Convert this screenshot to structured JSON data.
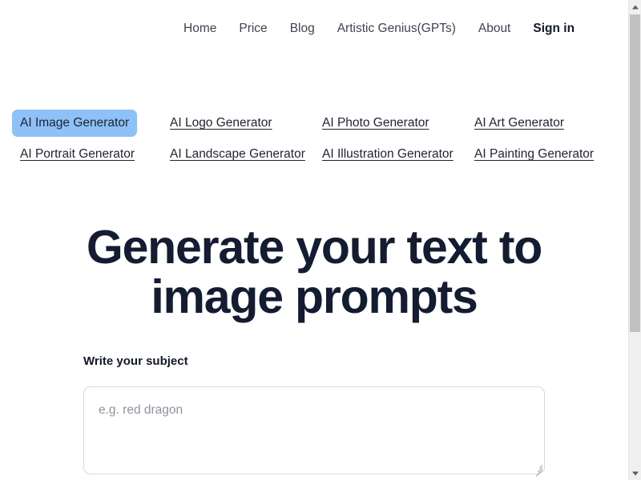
{
  "nav": {
    "items": [
      {
        "label": "Home",
        "emphasis": false
      },
      {
        "label": "Price",
        "emphasis": false
      },
      {
        "label": "Blog",
        "emphasis": false
      },
      {
        "label": "Artistic Genius(GPTs)",
        "emphasis": false
      },
      {
        "label": "About",
        "emphasis": false
      },
      {
        "label": "Sign in",
        "emphasis": true
      }
    ]
  },
  "generator_links": [
    {
      "label": "AI Image Generator",
      "selected": true
    },
    {
      "label": "AI Logo Generator",
      "selected": false
    },
    {
      "label": "AI Photo Generator",
      "selected": false
    },
    {
      "label": "AI Art Generator",
      "selected": false
    },
    {
      "label": "AI Portrait Generator",
      "selected": false
    },
    {
      "label": "AI Landscape Generator",
      "selected": false
    },
    {
      "label": "AI Illustration Generator",
      "selected": false
    },
    {
      "label": "AI Painting Generator",
      "selected": false
    }
  ],
  "hero": {
    "title": "Generate your text to image prompts"
  },
  "form": {
    "subject_label": "Write your subject",
    "subject_value": "",
    "subject_placeholder": "e.g. red dragon"
  },
  "colors": {
    "selection_highlight": "#8ec1f7",
    "heading": "#141c32",
    "link": "#1d2430",
    "placeholder": "#8e939e",
    "input_border": "#d6d8e0",
    "scrollbar_thumb": "#c1c1c1",
    "scrollbar_track": "#f0f0f0"
  },
  "scrollbar": {
    "up_arrow": "chevron-up-icon",
    "down_arrow": "chevron-down-icon"
  }
}
